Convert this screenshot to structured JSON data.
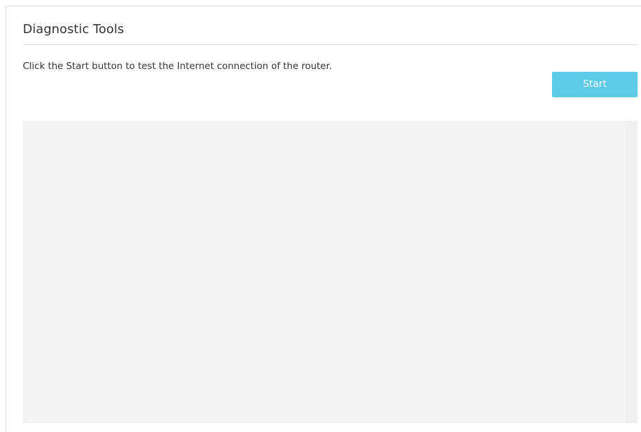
{
  "page": {
    "title": "Diagnostic Tools",
    "instruction": "Click the Start button to test the Internet connection of the router."
  },
  "actions": {
    "start_label": "Start"
  },
  "output": {
    "text": ""
  },
  "colors": {
    "accent": "#5bcbe8",
    "output_background": "#f4f4f4",
    "text": "#333333",
    "divider": "#d9d9d9"
  }
}
